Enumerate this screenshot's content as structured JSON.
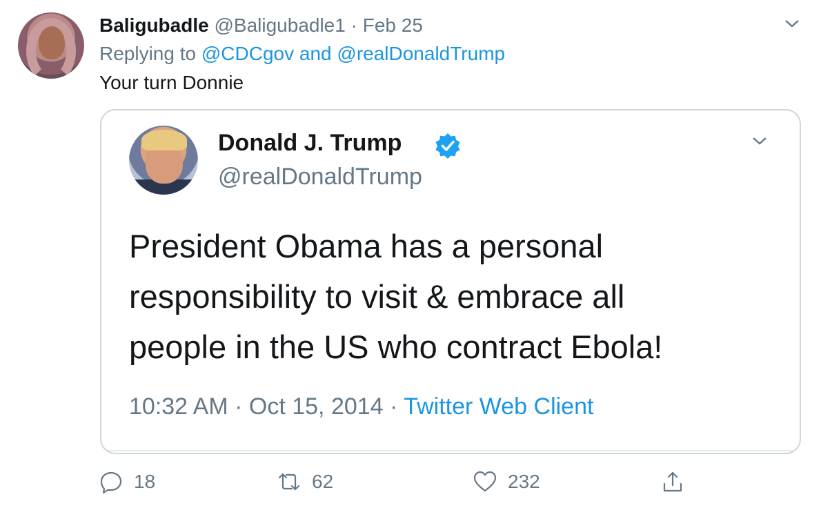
{
  "tweet": {
    "display_name": "Baligubadle",
    "handle": "@Baligubadle1",
    "separator": "·",
    "date": "Feb 25",
    "replying_prefix": "Replying to",
    "reply_to_1": "@CDCgov",
    "reply_and": "and",
    "reply_to_2": "@realDonaldTrump",
    "text": "Your turn Donnie"
  },
  "quoted_tweet": {
    "display_name": "Donald J. Trump",
    "handle": "@realDonaldTrump",
    "text_line_1": "President Obama has a personal",
    "text_line_2": "responsibility to visit & embrace all",
    "text_line_3": "people in the US who contract Ebola!",
    "time": "10:32 AM",
    "separator": "·",
    "date": "Oct 15, 2014",
    "source": "Twitter Web Client"
  },
  "actions": {
    "reply_count": "18",
    "retweet_count": "62",
    "like_count": "232"
  },
  "colors": {
    "link": "#1b95e0",
    "muted": "#657786",
    "border": "#ccd6dd",
    "verified": "#1da1f2"
  },
  "icons": [
    "chevron-down-icon",
    "verified-badge-icon",
    "reply-icon",
    "retweet-icon",
    "like-icon",
    "share-icon"
  ]
}
